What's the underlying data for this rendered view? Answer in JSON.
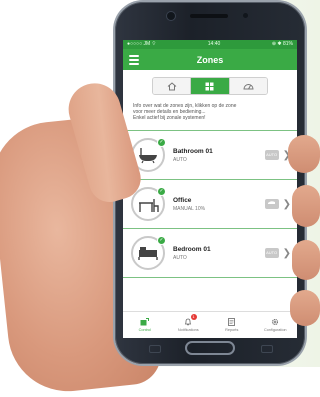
{
  "status_bar": {
    "carrier": "●○○○○ JM ⌔",
    "time": "14:40",
    "battery": "⊕ ✱ 81%"
  },
  "app_bar": {
    "title": "Zones",
    "menu_icon": "hamburger-icon"
  },
  "view_tabs": [
    {
      "icon": "home-icon",
      "active": false
    },
    {
      "icon": "grid-icon",
      "active": true
    },
    {
      "icon": "gauge-icon",
      "active": false
    }
  ],
  "info_text": {
    "line1": "Info over wat de zones zijn, klikken op de zone",
    "line2": "voor meer details en bediening...",
    "line3": "Enkel actief bij zonale systemen!"
  },
  "zones": [
    {
      "name": "Bathroom 01",
      "mode": "AUTO",
      "mode_chip": "AUTO",
      "icon": "bathtub-icon"
    },
    {
      "name": "Office",
      "mode": "MANUAL 10%",
      "mode_chip": "",
      "icon": "desk-icon"
    },
    {
      "name": "Bedroom 01",
      "mode": "AUTO",
      "mode_chip": "AUTO",
      "icon": "bed-icon"
    }
  ],
  "bottom_nav": [
    {
      "label": "Control",
      "icon": "control-icon",
      "active": true
    },
    {
      "label": "Notifications",
      "icon": "bell-icon",
      "active": false,
      "badge": "1"
    },
    {
      "label": "Reports",
      "icon": "report-icon",
      "active": false
    },
    {
      "label": "Configuration",
      "icon": "gear-icon",
      "active": false
    }
  ],
  "colors": {
    "brand_green": "#3aaa45",
    "status_green": "#2e9a3c",
    "divider_green": "#7cc283"
  }
}
